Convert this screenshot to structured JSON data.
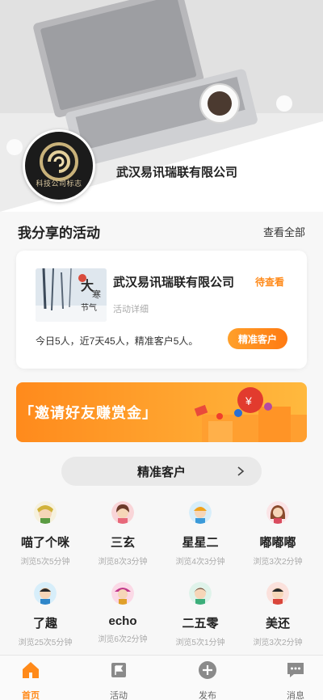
{
  "hero": {
    "company_name": "武汉易讯瑞联有限公司",
    "logo_text": "科技公司标志"
  },
  "section": {
    "title": "我分享的活动",
    "view_all": "查看全部"
  },
  "activity_card": {
    "title": "武汉易讯瑞联有限公司",
    "status": "待查看",
    "subtitle": "活动详细",
    "stats": "今日5人，近7天45人，精准客户5人。",
    "button": "精准客户",
    "thumb_text_1": "大",
    "thumb_text_2": "寒",
    "thumb_text_3": "节气"
  },
  "banner": {
    "text": "「邀请好友赚赏金」"
  },
  "pill_button": {
    "label": "精准客户"
  },
  "visitors": [
    {
      "name": "喵了个咪",
      "meta": "浏览5次5分钟"
    },
    {
      "name": "三玄",
      "meta": "浏览8次3分钟"
    },
    {
      "name": "星星二",
      "meta": "浏览4次3分钟"
    },
    {
      "name": "嘟嘟嘟",
      "meta": "浏览3次2分钟"
    },
    {
      "name": "了趣",
      "meta": "浏览25次5分钟"
    },
    {
      "name": "echo",
      "meta": "浏览6次2分钟"
    },
    {
      "name": "二五零",
      "meta": "浏览5次1分钟"
    },
    {
      "name": "美还",
      "meta": "浏览3次2分钟"
    }
  ],
  "tabbar": [
    {
      "label": "首页",
      "icon": "home-icon",
      "active": true
    },
    {
      "label": "活动",
      "icon": "flag-icon",
      "active": false
    },
    {
      "label": "发布",
      "icon": "plus-circle-icon",
      "active": false
    },
    {
      "label": "消息",
      "icon": "message-icon",
      "active": false
    }
  ],
  "colors": {
    "accent": "#ff8a1a",
    "tab_inactive": "#888888"
  }
}
